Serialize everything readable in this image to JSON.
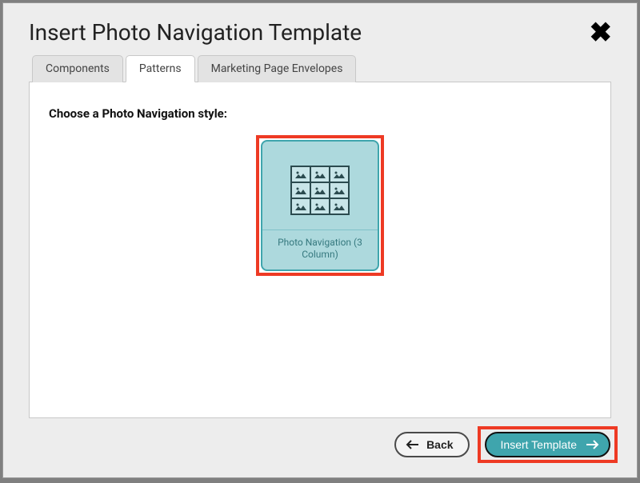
{
  "dialog": {
    "title": "Insert Photo Navigation Template"
  },
  "tabs": {
    "components": "Components",
    "patterns": "Patterns",
    "marketing": "Marketing Page Envelopes"
  },
  "content": {
    "instruction": "Choose a Photo Navigation style:",
    "template_label": "Photo Navigation (3 Column)"
  },
  "footer": {
    "back_label": "Back",
    "insert_label": "Insert Template"
  }
}
